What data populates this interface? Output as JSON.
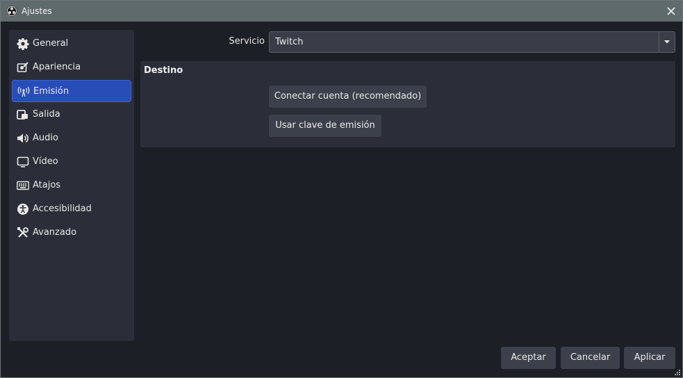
{
  "window": {
    "title": "Ajustes"
  },
  "sidebar": {
    "items": [
      {
        "label": "General",
        "icon": "gear-icon"
      },
      {
        "label": "Apariencia",
        "icon": "palette-icon"
      },
      {
        "label": "Emisión",
        "icon": "antenna-icon",
        "active": true
      },
      {
        "label": "Salida",
        "icon": "output-icon"
      },
      {
        "label": "Audio",
        "icon": "speaker-icon"
      },
      {
        "label": "Vídeo",
        "icon": "monitor-icon"
      },
      {
        "label": "Atajos",
        "icon": "keyboard-icon"
      },
      {
        "label": "Accesibilidad",
        "icon": "accessibility-icon"
      },
      {
        "label": "Avanzado",
        "icon": "tools-icon"
      }
    ]
  },
  "service": {
    "label": "Servicio",
    "value": "Twitch"
  },
  "destination": {
    "title": "Destino",
    "connect_label": "Conectar cuenta (recomendado)",
    "stream_key_label": "Usar clave de emisión"
  },
  "footer": {
    "accept": "Aceptar",
    "cancel": "Cancelar",
    "apply": "Aplicar"
  },
  "colors": {
    "accent": "#284cb8",
    "panel": "#2b2e38",
    "background": "#1d1f26",
    "titlebar": "#5f6a6d"
  }
}
